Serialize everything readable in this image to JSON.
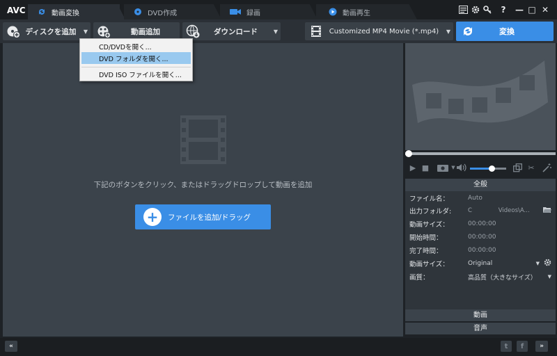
{
  "app": {
    "logo": "AVC"
  },
  "tabs": [
    {
      "label": "動画変換",
      "icon": "refresh-icon",
      "active": true
    },
    {
      "label": "DVD作成",
      "icon": "disc-icon",
      "active": false
    },
    {
      "label": "録画",
      "icon": "camera-icon",
      "active": false
    },
    {
      "label": "動画再生",
      "icon": "play-icon",
      "active": false
    }
  ],
  "window": {
    "help": "?",
    "minimize": "—",
    "maximize": "□",
    "close": "✕"
  },
  "toolbar": {
    "add_disc": "ディスクを追加",
    "add_video": "動画追加",
    "download": "ダウンロード",
    "format": "Customized MP4 Movie (*.mp4)",
    "convert": "変換"
  },
  "dropdown": {
    "items": [
      "CD/DVDを開く...",
      "DVD フォルダを開く...",
      "DVD ISO ファイルを開く..."
    ],
    "highlighted_index": 1
  },
  "main": {
    "hint": "下記のボタンをクリック、またはドラッグドロップして動画を追加",
    "add_file_button": "ファイルを追加/ドラッグ"
  },
  "player": {
    "seek_position": 0.0,
    "volume": 0.6
  },
  "settings": {
    "header": "全般",
    "rows": [
      {
        "key": "ファイル名：",
        "value": "Auto"
      },
      {
        "key": "出力フォルダ:",
        "value": "C              Videos\\A..."
      },
      {
        "key": "動画サイズ：",
        "value": "00:00:00"
      },
      {
        "key": "開始時間：",
        "value": "00:00:00"
      },
      {
        "key": "完了時間：",
        "value": "00:00:00"
      },
      {
        "key": "動画サイズ：",
        "value": "Original"
      },
      {
        "key": "画質：",
        "value": "高品質（大きなサイズ）"
      }
    ],
    "section_video": "動画",
    "section_audio": "音声"
  },
  "bottom": {
    "collapse": "«",
    "expand": "»",
    "twitter": "t",
    "facebook": "f"
  }
}
